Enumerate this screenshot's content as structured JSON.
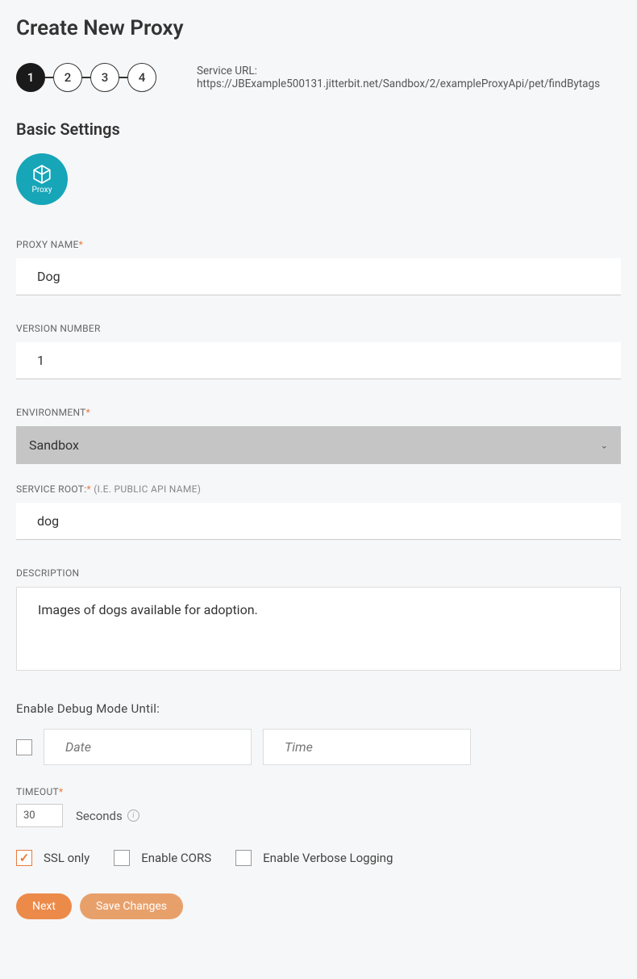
{
  "page": {
    "title": "Create New Proxy",
    "service_url_label": "Service URL: https://JBExample500131.jitterbit.net/Sandbox/2/exampleProxyApi/pet/findBytags"
  },
  "stepper": {
    "steps": [
      "1",
      "2",
      "3",
      "4"
    ],
    "active": 0
  },
  "section": {
    "title": "Basic Settings",
    "badge_text": "Proxy"
  },
  "fields": {
    "proxy_name": {
      "label": "PROXY NAME",
      "value": "Dog"
    },
    "version": {
      "label": "VERSION NUMBER",
      "value": "1"
    },
    "environment": {
      "label": "ENVIRONMENT",
      "value": "Sandbox"
    },
    "service_root": {
      "label": "SERVICE ROOT:",
      "hint": " (I.E. PUBLIC API NAME)",
      "value": "dog"
    },
    "description": {
      "label": "DESCRIPTION",
      "value": "Images of dogs available for adoption."
    },
    "debug": {
      "label": "Enable Debug Mode Until:",
      "date_placeholder": "Date",
      "time_placeholder": "Time",
      "checked": false
    },
    "timeout": {
      "label": "TIMEOUT",
      "value": "30",
      "unit": "Seconds"
    }
  },
  "options": {
    "ssl": {
      "label": "SSL only",
      "checked": true
    },
    "cors": {
      "label": "Enable CORS",
      "checked": false
    },
    "verbose": {
      "label": "Enable Verbose Logging",
      "checked": false
    }
  },
  "buttons": {
    "next": "Next",
    "save": "Save Changes"
  }
}
